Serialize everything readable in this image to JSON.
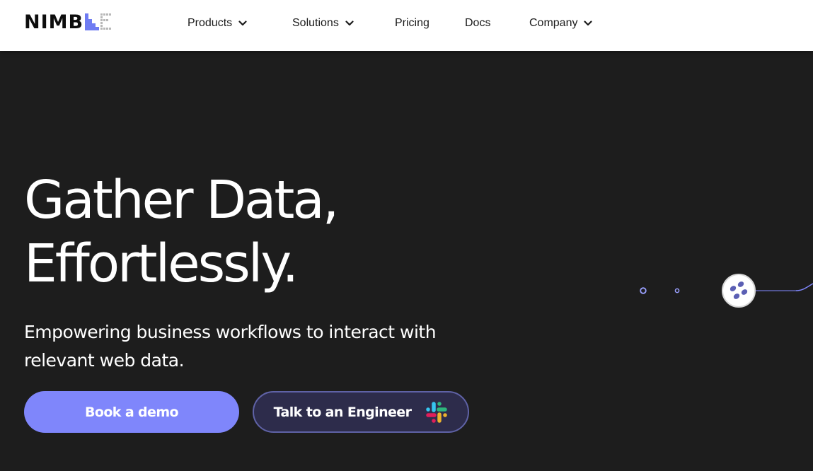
{
  "header": {
    "logo_text": "NIMB",
    "nav": [
      {
        "label": "Products",
        "has_dropdown": true
      },
      {
        "label": "Solutions",
        "has_dropdown": true
      },
      {
        "label": "Pricing",
        "has_dropdown": false
      },
      {
        "label": "Docs",
        "has_dropdown": false
      },
      {
        "label": "Company",
        "has_dropdown": true
      }
    ]
  },
  "hero": {
    "headline_line1": "Gather Data,",
    "headline_line2": "Effortlessly.",
    "subheadline": "Empowering business workflows to interact with relevant web data.",
    "primary_button": "Book a demo",
    "secondary_button": "Talk to an Engineer"
  },
  "colors": {
    "background": "#1d1d1d",
    "header_background": "#ffffff",
    "accent": "#7f86fb",
    "secondary_button_bg": "#2d2c4b",
    "secondary_button_border": "#5f62a6"
  },
  "icons": [
    "chevron-down-icon",
    "slack-icon",
    "node-icon",
    "logo-mark-icon"
  ]
}
